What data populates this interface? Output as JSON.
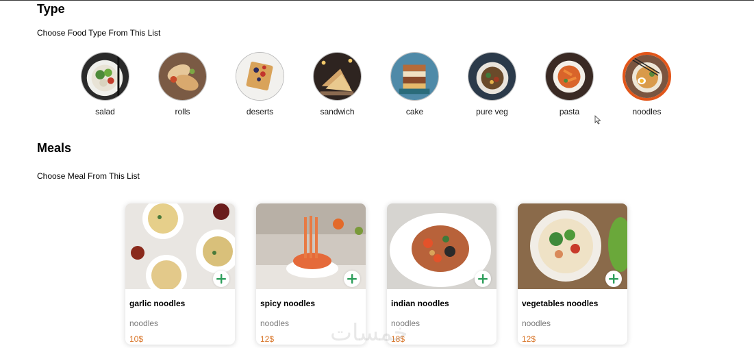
{
  "type_section": {
    "title": "Type",
    "subtitle": "Choose Food Type From This List",
    "items": [
      {
        "label": "salad",
        "icon": "salad-image",
        "selected": false
      },
      {
        "label": "rolls",
        "icon": "rolls-image",
        "selected": false
      },
      {
        "label": "deserts",
        "icon": "deserts-image",
        "selected": false
      },
      {
        "label": "sandwich",
        "icon": "sandwich-image",
        "selected": false
      },
      {
        "label": "cake",
        "icon": "cake-image",
        "selected": false
      },
      {
        "label": "pure veg",
        "icon": "pure-veg-image",
        "selected": false
      },
      {
        "label": "pasta",
        "icon": "pasta-image",
        "selected": false
      },
      {
        "label": "noodles",
        "icon": "noodles-image",
        "selected": true
      }
    ],
    "selected_border_color": "#e2561a"
  },
  "meals_section": {
    "title": "Meals",
    "subtitle": "Choose Meal From This List",
    "items": [
      {
        "name": "garlic noodles",
        "category": "noodles",
        "price": "10$",
        "icon": "garlic-noodles-image"
      },
      {
        "name": "spicy noodles",
        "category": "noodles",
        "price": "12$",
        "icon": "spicy-noodles-image"
      },
      {
        "name": "indian noodles",
        "category": "noodles",
        "price": "18$",
        "icon": "indian-noodles-image"
      },
      {
        "name": "vegetables noodles",
        "category": "noodles",
        "price": "12$",
        "icon": "vegetables-noodles-image"
      }
    ],
    "add_button_icon": "plus-icon",
    "add_button_color": "#2e9e5b",
    "price_color": "#d9772b"
  },
  "watermark": "خمسات"
}
